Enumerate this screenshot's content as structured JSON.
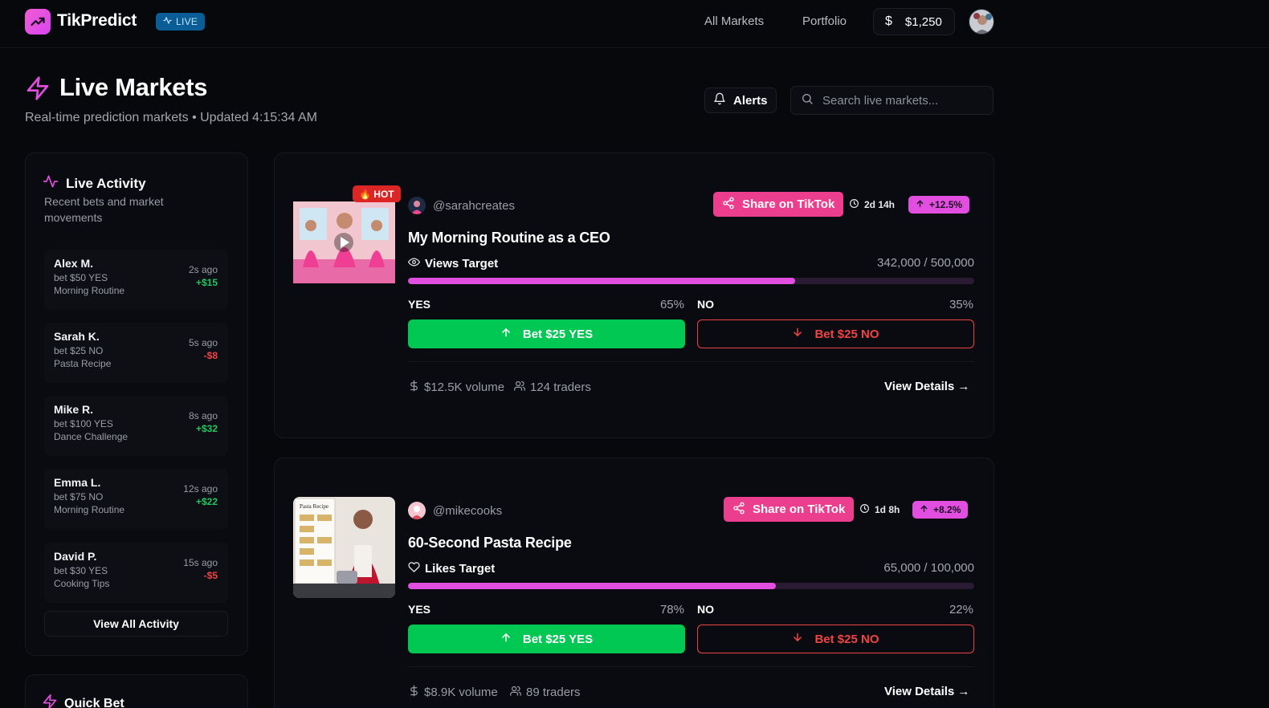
{
  "nav": {
    "brand": "TikPredict",
    "live_label": "LIVE",
    "links": [
      "All Markets",
      "Portfolio"
    ],
    "balance": "$1,250",
    "balance_icon": "dollar-icon"
  },
  "header": {
    "title": "Live Markets",
    "subtitle": "Real-time prediction markets • Updated 4:15:34 AM",
    "alerts_label": "Alerts",
    "search_placeholder": "Search live markets..."
  },
  "activity": {
    "title": "Live Activity",
    "subtitle": "Recent bets and market movements",
    "items": [
      {
        "name": "Alex M.",
        "bet": "bet $50 YES",
        "market": "Morning Routine",
        "time": "2s ago",
        "delta": "+$15",
        "positive": true
      },
      {
        "name": "Sarah K.",
        "bet": "bet $25 NO",
        "market": "Pasta Recipe",
        "time": "5s ago",
        "delta": "-$8",
        "positive": false
      },
      {
        "name": "Mike R.",
        "bet": "bet $100 YES",
        "market": "Dance Challenge",
        "time": "8s ago",
        "delta": "+$32",
        "positive": true
      },
      {
        "name": "Emma L.",
        "bet": "bet $75 NO",
        "market": "Morning Routine",
        "time": "12s ago",
        "delta": "+$22",
        "positive": true
      },
      {
        "name": "David P.",
        "bet": "bet $30 YES",
        "market": "Cooking Tips",
        "time": "15s ago",
        "delta": "-$5",
        "positive": false
      }
    ],
    "view_all_label": "View All Activity"
  },
  "quick_bet": {
    "title": "Quick Bet"
  },
  "markets": [
    {
      "hot_label": "🔥 HOT",
      "creator": "@sarahcreates",
      "share_label": "Share on TikTok",
      "time_left": "2d 14h",
      "trend": "+12.5%",
      "title": "My Morning Routine as a CEO",
      "target_label": "Views Target",
      "target_icon": "eye-icon",
      "target_value": "342,000 / 500,000",
      "progress": 0.684,
      "yes_label": "YES",
      "yes_pct": "65%",
      "no_label": "NO",
      "no_pct": "35%",
      "yes_button": "Bet $25 YES",
      "no_button": "Bet $25 NO",
      "volume": "$12.5K volume",
      "traders": "124 traders",
      "details_label": "View Details →"
    },
    {
      "creator": "@mikecooks",
      "share_label": "Share on TikTok",
      "time_left": "1d 8h",
      "trend": "+8.2%",
      "title": "60-Second Pasta Recipe",
      "thumb_text": "Pasta Recipe",
      "target_label": "Likes Target",
      "target_icon": "heart-icon",
      "target_value": "65,000 / 100,000",
      "progress": 0.65,
      "yes_label": "YES",
      "yes_pct": "78%",
      "no_label": "NO",
      "no_pct": "22%",
      "yes_button": "Bet $25 YES",
      "no_button": "Bet $25 NO",
      "volume": "$8.9K volume",
      "traders": "89 traders",
      "details_label": "View Details →"
    }
  ],
  "colors": {
    "accent": "#e24fe0",
    "share": "#ec3e8f",
    "yes": "#00c853",
    "no": "#ef4444",
    "background": "#07080c"
  }
}
